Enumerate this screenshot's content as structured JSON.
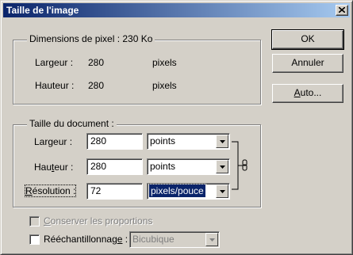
{
  "window": {
    "title": "Taille de l'image"
  },
  "pixel_dims": {
    "label": "Dimensions de pixel : 230 Ko",
    "width": {
      "label": "Largeur :",
      "value": "280",
      "unit": "pixels"
    },
    "height": {
      "label": "Hauteur :",
      "value": "280",
      "unit": "pixels"
    }
  },
  "doc_size": {
    "label": "Taille du document :",
    "width": {
      "label_pre": "Lar",
      "label_key": "g",
      "label_post": "eur :",
      "value": "280",
      "unit": "points"
    },
    "height": {
      "label_pre": "Hau",
      "label_key": "t",
      "label_post": "eur :",
      "value": "280",
      "unit": "points"
    },
    "resolution": {
      "label_pre": "",
      "label_key": "R",
      "label_post": "ésolution :",
      "value": "72",
      "unit": "pixels/pouce"
    }
  },
  "options": {
    "constrain": {
      "label_key": "C",
      "label_post": "onserver les proportions",
      "checked": false,
      "enabled": false
    },
    "resample": {
      "label_pre": "Rééchantillonnag",
      "label_key": "e",
      "label_post": " :",
      "checked": false,
      "method": "Bicubique"
    }
  },
  "buttons": {
    "ok": "OK",
    "cancel": "Annuler",
    "auto_pre": "",
    "auto_key": "A",
    "auto_post": "uto..."
  },
  "icons": {
    "close": "close-icon",
    "link": "chain-link-icon",
    "dropdown": "chevron-down-icon"
  },
  "colors": {
    "titlebar_start": "#0a246a",
    "titlebar_end": "#a6caf0",
    "face": "#d4d0c8"
  }
}
